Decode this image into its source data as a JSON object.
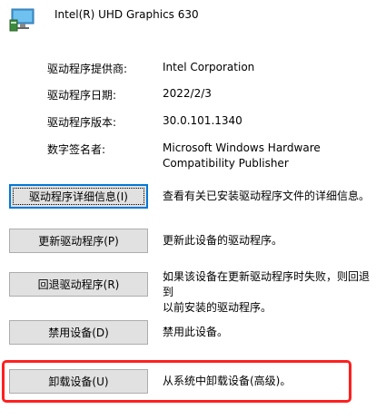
{
  "device": {
    "title": "Intel(R) UHD Graphics 630",
    "icon": "display-adapter-icon"
  },
  "info": [
    {
      "label": "驱动程序提供商:",
      "value": "Intel Corporation"
    },
    {
      "label": "驱动程序日期:",
      "value": "2022/2/3"
    },
    {
      "label": "驱动程序版本:",
      "value": "30.0.101.1340"
    },
    {
      "label": "数字签名者:",
      "value_line1": "Microsoft Windows Hardware",
      "value_line2": "Compatibility Publisher"
    }
  ],
  "actions": [
    {
      "button": "驱动程序详细信息(I)",
      "description": "查看有关已安装驱动程序文件的详细信息。"
    },
    {
      "button": "更新驱动程序(P)",
      "description": "更新此设备的驱动程序。"
    },
    {
      "button": "回退驱动程序(R)",
      "description_line1": "如果该设备在更新驱动程序时失败，则回退到",
      "description_line2": "以前安装的驱动程序。"
    },
    {
      "button": "禁用设备(D)",
      "description": "禁用此设备。"
    },
    {
      "button": "卸载设备(U)",
      "description": "从系统中卸载设备(高级)。"
    }
  ],
  "colors": {
    "highlight": "#ff1f1f",
    "focus": "#0078d7",
    "button_bg": "#e1e1e1"
  }
}
